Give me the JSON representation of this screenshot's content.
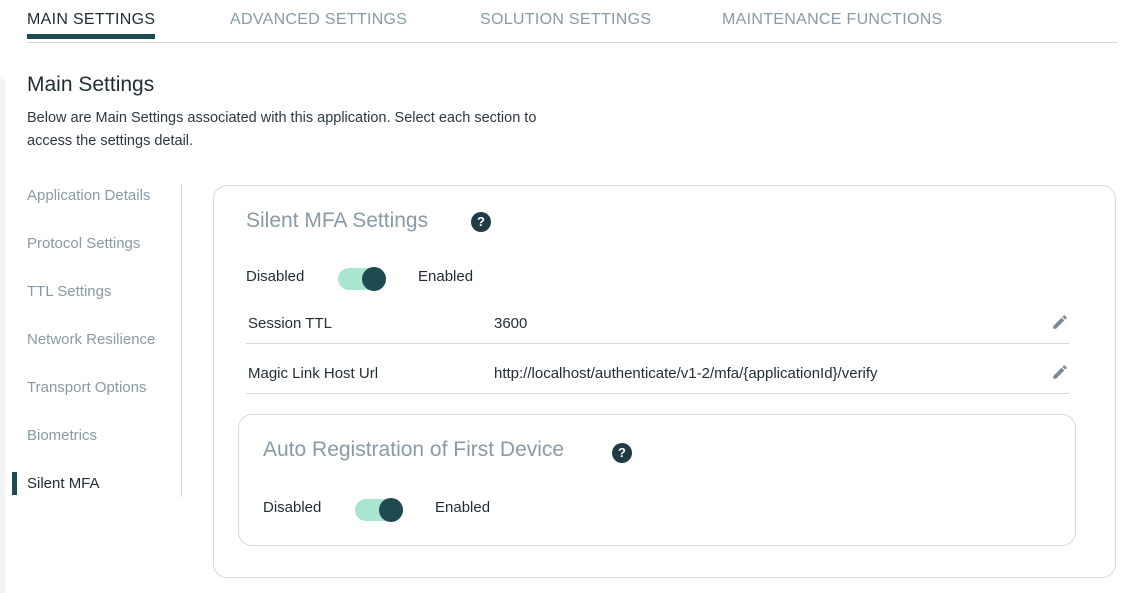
{
  "tabs": [
    {
      "label": "MAIN SETTINGS",
      "active": true
    },
    {
      "label": "ADVANCED SETTINGS",
      "active": false
    },
    {
      "label": "SOLUTION SETTINGS",
      "active": false
    },
    {
      "label": "MAINTENANCE FUNCTIONS",
      "active": false
    }
  ],
  "header": {
    "title": "Main Settings",
    "description": "Below are Main Settings associated with this application. Select each section to access the settings detail."
  },
  "sidenav": {
    "items": [
      {
        "label": "Application Details",
        "active": false
      },
      {
        "label": "Protocol Settings",
        "active": false
      },
      {
        "label": "TTL Settings",
        "active": false
      },
      {
        "label": "Network Resilience",
        "active": false
      },
      {
        "label": "Transport Options",
        "active": false
      },
      {
        "label": "Biometrics",
        "active": false
      },
      {
        "label": "Silent MFA",
        "active": true
      }
    ]
  },
  "silent_mfa": {
    "title": "Silent MFA Settings",
    "help_icon": "question-circle-icon",
    "toggle": {
      "off_label": "Disabled",
      "on_label": "Enabled",
      "state": "enabled"
    },
    "fields": [
      {
        "label": "Session TTL",
        "value": "3600",
        "icon": "pencil-icon"
      },
      {
        "label": "Magic Link Host Url",
        "value": "http://localhost/authenticate/v1-2/mfa/{applicationId}/verify",
        "icon": "pencil-icon"
      }
    ]
  },
  "auto_registration": {
    "title": "Auto Registration of First Device",
    "help_icon": "question-circle-icon",
    "toggle": {
      "off_label": "Disabled",
      "on_label": "Enabled",
      "state": "enabled"
    }
  },
  "colors": {
    "accent": "#1f4a52",
    "toggle_track": "#a8e6cf",
    "muted_text": "#8a9aa4",
    "border": "#d5d9dc"
  }
}
